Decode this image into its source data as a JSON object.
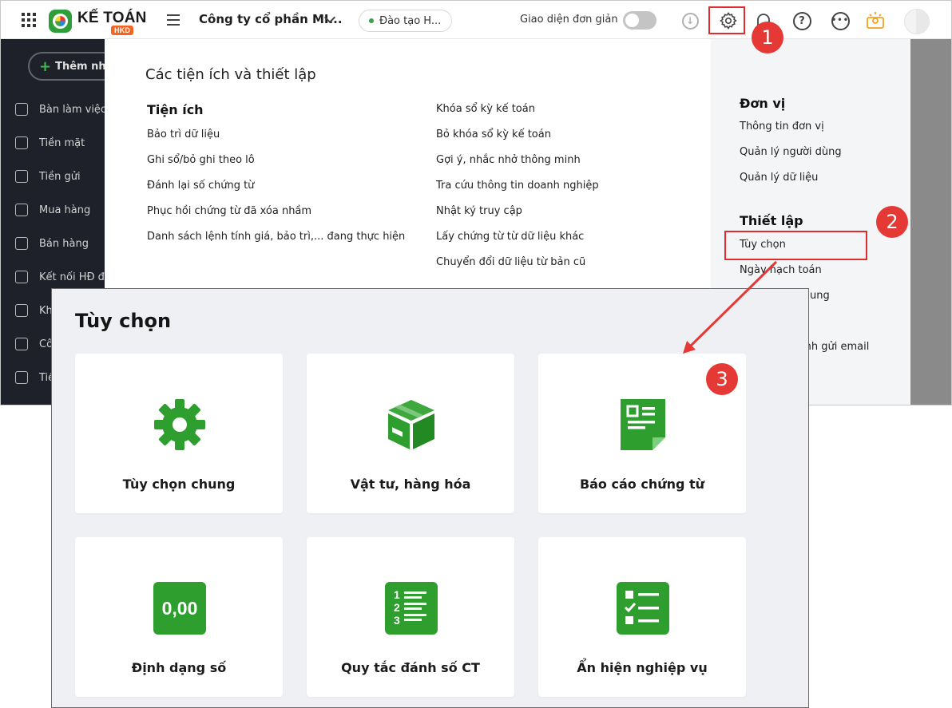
{
  "topbar": {
    "logo_text": "KẾ TOÁN",
    "logo_badge": "HKD",
    "company": "Công ty cổ phần MI...",
    "training": "Đào tạo H...",
    "simple_ui": "Giao diện đơn giản"
  },
  "sidebar": {
    "add_label": "Thêm nha",
    "items": [
      {
        "label": "Bàn làm việc"
      },
      {
        "label": "Tiền mặt"
      },
      {
        "label": "Tiền gửi"
      },
      {
        "label": "Mua hàng"
      },
      {
        "label": "Bán hàng"
      },
      {
        "label": "Kết nối HĐ đi"
      },
      {
        "label": "Kh"
      },
      {
        "label": "Cô"
      },
      {
        "label": "Tiề"
      }
    ]
  },
  "settings_panel": {
    "title": "Các tiện ích và thiết lập",
    "utilities_heading": "Tiện ích",
    "utilities_col1": [
      "Bảo trì dữ liệu",
      "Ghi sổ/bỏ ghi theo lô",
      "Đánh lại số chứng từ",
      "Phục hồi chứng từ đã xóa nhầm",
      "Danh sách lệnh tính giá, bảo trì,... đang thực hiện"
    ],
    "utilities_col2": [
      "Khóa sổ kỳ kế toán",
      "Bỏ khóa sổ kỳ kế toán",
      "Gợi ý, nhắc nhở thông minh",
      "Tra cứu thông tin doanh nghiệp",
      "Nhật ký truy cập",
      "Lấy chứng từ từ dữ liệu khác",
      "Chuyển đổi dữ liệu từ bản cũ"
    ]
  },
  "right_panel": {
    "unit_heading": "Đơn vị",
    "unit_items": [
      "Thông tin đơn vị",
      "Quản lý người dùng",
      "Quản lý dữ liệu"
    ],
    "setup_heading": "Thiết lập",
    "setup_items": [
      "Tùy chọn",
      "Ngày hạch toán",
      "ung",
      "ình gửi email"
    ]
  },
  "steps": [
    "1",
    "2",
    "3"
  ],
  "dialog": {
    "title": "Tùy chọn",
    "cards": [
      {
        "label": "Tùy chọn chung",
        "icon": "gear-icon"
      },
      {
        "label": "Vật tư, hàng hóa",
        "icon": "box-icon"
      },
      {
        "label": "Báo cáo chứng từ",
        "icon": "document-icon"
      },
      {
        "label": "Định dạng số",
        "icon": "number-format-icon",
        "icon_text": "0,00"
      },
      {
        "label": "Quy tắc đánh số CT",
        "icon": "numbered-list-icon",
        "icon_digits": [
          "1",
          "2",
          "3"
        ]
      },
      {
        "label": "Ẩn hiện nghiệp vụ",
        "icon": "checklist-icon"
      }
    ]
  },
  "colors": {
    "accent_green": "#2e9e2e",
    "highlight_red": "#e32b2b",
    "badge_red": "#e53935",
    "sidebar_bg": "#1e2129"
  }
}
